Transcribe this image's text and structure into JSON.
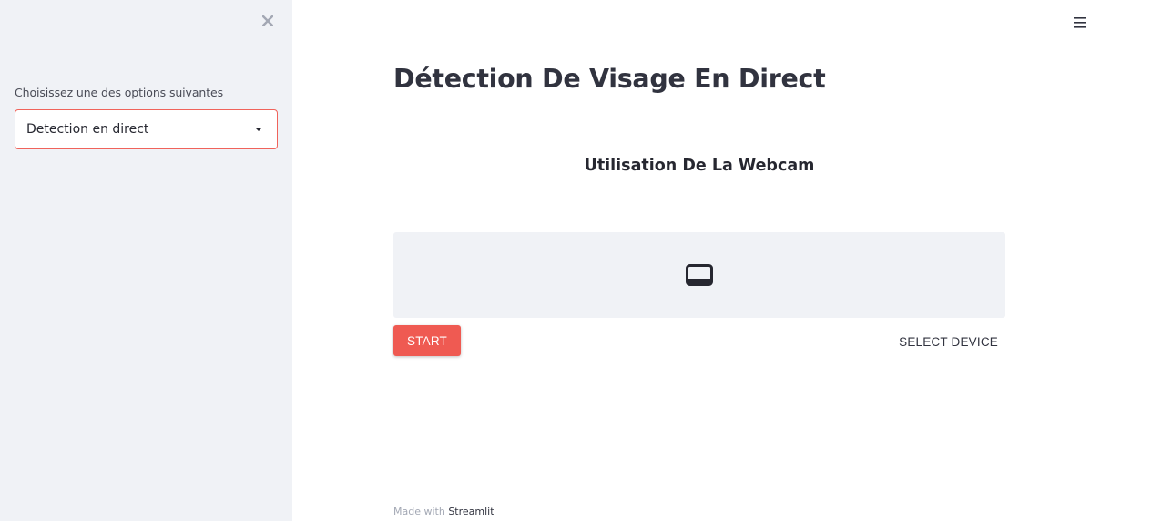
{
  "sidebar": {
    "close_icon": "close-icon",
    "select_label": "Choisissez une des options suivantes",
    "select_value": "Detection en direct",
    "select_border_color": "#f0635b"
  },
  "header": {
    "menu_icon": "hamburger-menu-icon"
  },
  "main": {
    "title": "Détection De Visage En Direct",
    "subtitle": "Utilisation De La Webcam",
    "video_icon": "video-placeholder-icon",
    "start_label": "START",
    "start_color": "#ef5a52",
    "select_device_label": "SELECT DEVICE"
  },
  "footer": {
    "prefix": "Made with",
    "link": "Streamlit"
  }
}
